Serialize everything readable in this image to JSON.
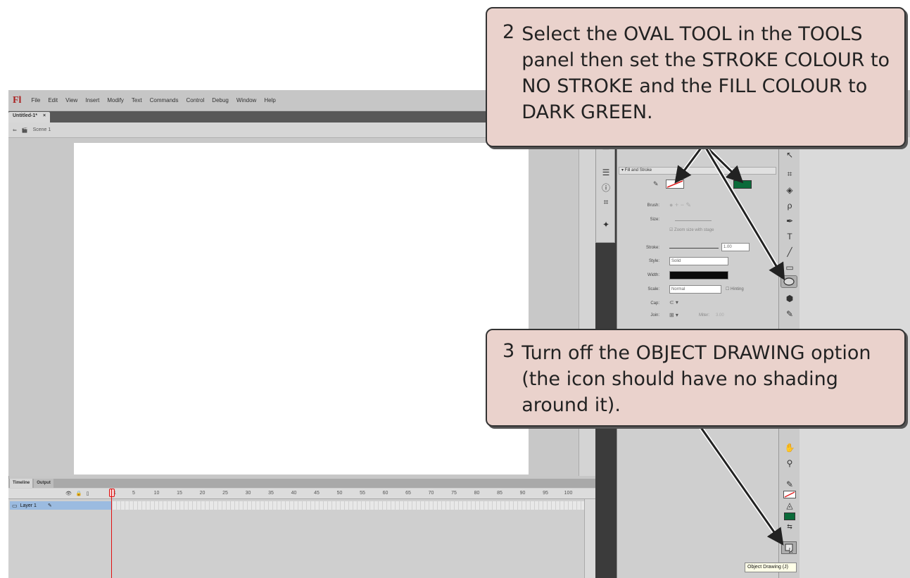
{
  "menubar": {
    "logo": "Fl",
    "items": [
      "File",
      "Edit",
      "View",
      "Insert",
      "Modify",
      "Text",
      "Commands",
      "Control",
      "Debug",
      "Window",
      "Help"
    ]
  },
  "document": {
    "tab_label": "Untitled-1*",
    "tab_close": "×"
  },
  "scene": {
    "label": "Scene 1"
  },
  "timeline": {
    "tabs": [
      "Timeline",
      "Output"
    ],
    "frame_numbers": [
      "1",
      "5",
      "10",
      "15",
      "20",
      "25",
      "30",
      "35",
      "40",
      "45",
      "50",
      "55",
      "60",
      "65",
      "70",
      "75",
      "80",
      "85",
      "90",
      "95",
      "100"
    ],
    "layer_name": "Layer 1"
  },
  "properties": {
    "section": "▾ Fill and Stroke",
    "brush_label": "Brush:",
    "size_label": "Size:",
    "zoom_label": "Zoom size with stage",
    "stroke_label": "Stroke:",
    "stroke_value": "1.00",
    "style_label": "Style:",
    "style_value": "Solid",
    "width_label": "Width:",
    "scale_label": "Scale:",
    "scale_value": "Normal",
    "hinting_label": "Hinting",
    "cap_label": "Cap:",
    "join_label": "Join:",
    "miter_label": "Miter:",
    "miter_value": "3.00"
  },
  "colors": {
    "fill": "#0b6b3a",
    "callout_bg": "#ead2cc",
    "playhead": "#e01010"
  },
  "tooltip": "Object Drawing (J)",
  "callout2": {
    "number": "2",
    "text": "Select the OVAL TOOL in the TOOLS panel then set the STROKE COLOUR to NO STROKE and the FILL COLOUR to DARK GREEN."
  },
  "callout3": {
    "number": "3",
    "text": "Turn off the OBJECT DRAWING option (the icon should have no shading around it)."
  }
}
